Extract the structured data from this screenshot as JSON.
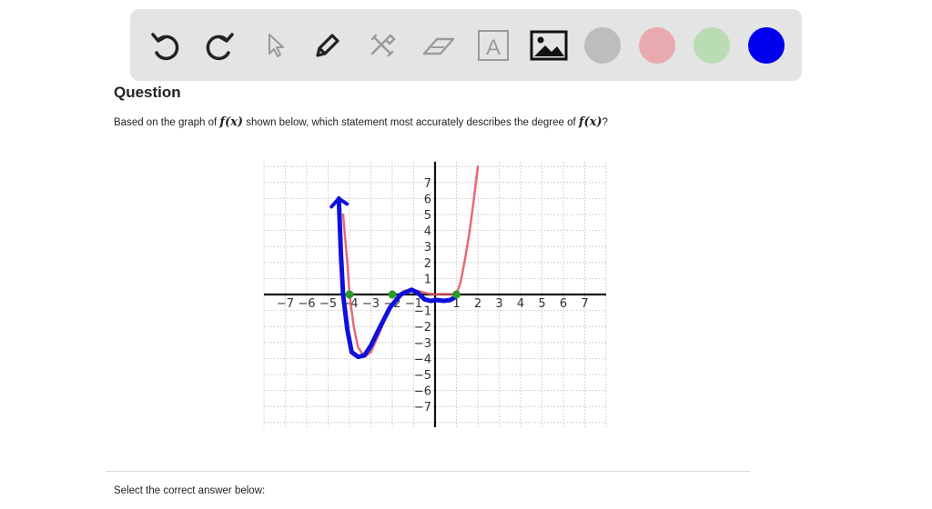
{
  "toolbar": {
    "tools": [
      {
        "name": "undo-icon"
      },
      {
        "name": "redo-icon"
      },
      {
        "name": "pointer-icon"
      },
      {
        "name": "pen-icon"
      },
      {
        "name": "tools-icon"
      },
      {
        "name": "eraser-icon"
      },
      {
        "name": "text-icon",
        "glyph": "A"
      },
      {
        "name": "image-icon"
      }
    ],
    "colors": [
      "#bdbdbd",
      "#e8aab0",
      "#b9dcb3",
      "#0000ee"
    ]
  },
  "question": {
    "heading": "Question",
    "text_before": "Based on the graph of ",
    "func": "f(x)",
    "text_middle": " shown below, which statement most accurately describes the degree of ",
    "text_after": "?"
  },
  "footer": {
    "select_text": "Select the correct answer below:"
  },
  "chart_data": {
    "type": "line",
    "x_ticks": [
      "−7",
      "−6",
      "−5",
      "−4",
      "−3",
      "−2",
      "−1",
      "1",
      "2",
      "3",
      "4",
      "5",
      "6",
      "7"
    ],
    "y_ticks": [
      "7",
      "6",
      "5",
      "4",
      "3",
      "2",
      "1",
      "−1",
      "−2",
      "−3",
      "−4",
      "−5",
      "−6",
      "−7"
    ],
    "xlim": [
      -8,
      8
    ],
    "ylim": [
      -8,
      8
    ],
    "grid": true,
    "series": [
      {
        "color": "#e05060",
        "x": [
          -4.3,
          -4.1,
          -4.0,
          -3.8,
          -3.6,
          -3.3,
          -3.0,
          -2.6,
          -2.2,
          -1.8,
          -1.5,
          -1.2,
          -0.9,
          -0.6,
          -0.3,
          0,
          0.3,
          0.6,
          0.9,
          1.0,
          1.2,
          1.4,
          1.6,
          1.8,
          2.0
        ],
        "y": [
          5.0,
          2.0,
          0,
          -2.0,
          -3.3,
          -3.9,
          -3.6,
          -2.4,
          -1.1,
          -0.2,
          0.2,
          0.3,
          0.25,
          0.15,
          0.05,
          0,
          0.02,
          0.03,
          0.01,
          0,
          0.8,
          2.2,
          3.8,
          5.8,
          8.0
        ]
      },
      {
        "color": "#1010dd",
        "x": [
          -4.5,
          -4.4,
          -4.3,
          -4.1,
          -3.9,
          -3.6,
          -3.3,
          -3.0,
          -2.6,
          -2.1,
          -1.6,
          -1.1,
          -0.8,
          -0.5,
          -0.2,
          0.1,
          0.4,
          0.7,
          0.9
        ],
        "y": [
          6.0,
          2.5,
          0,
          -2.2,
          -3.6,
          -3.9,
          -3.8,
          -3.2,
          -2.1,
          -0.8,
          0,
          0.3,
          0.1,
          -0.3,
          -0.4,
          -0.35,
          -0.4,
          -0.35,
          -0.2
        ]
      }
    ],
    "zeros": [
      -4,
      -2,
      1
    ],
    "zeros_color": "#2a9a2a"
  }
}
